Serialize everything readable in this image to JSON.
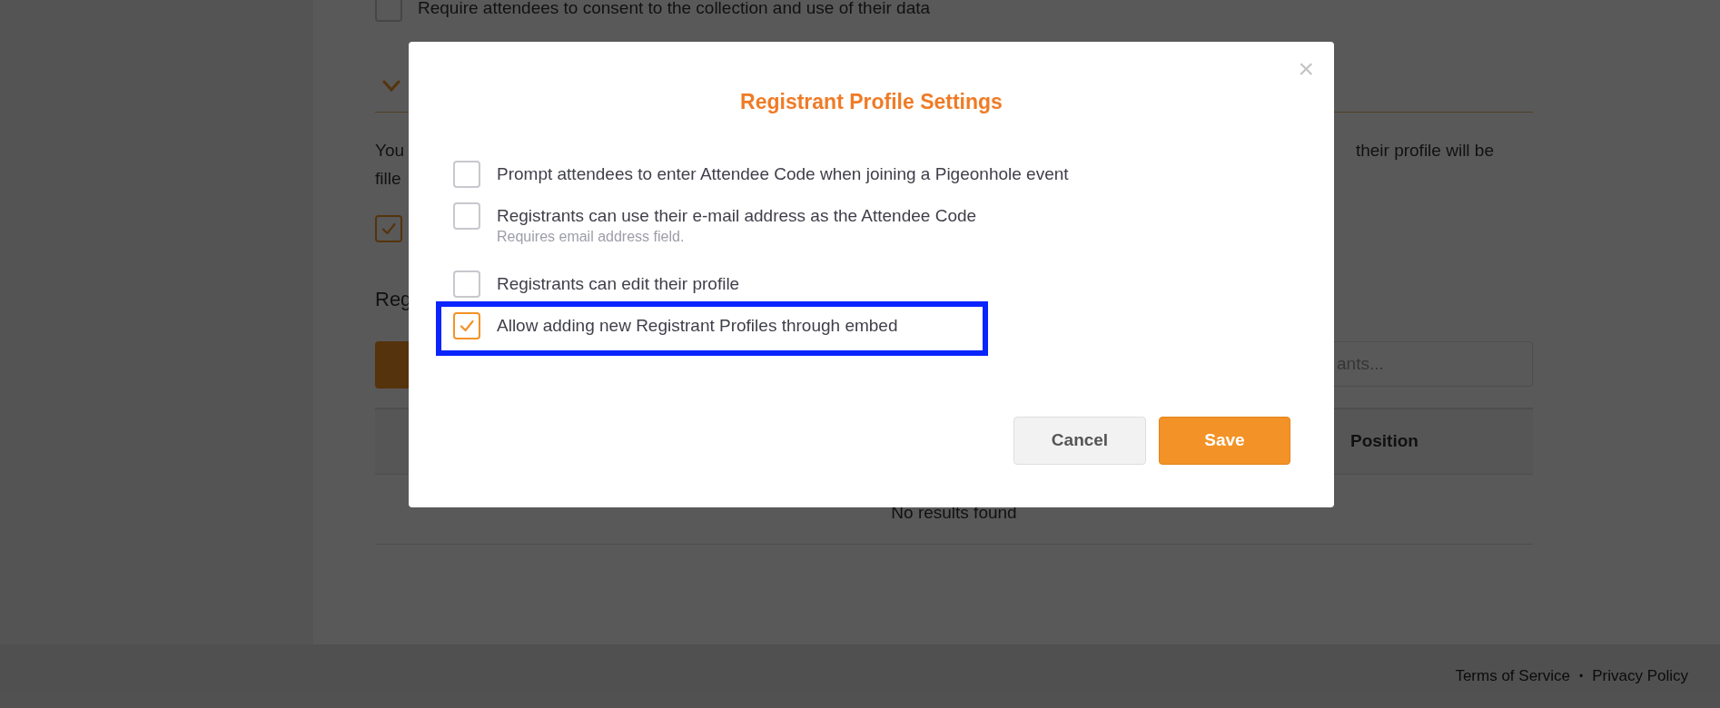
{
  "background": {
    "consent_option": {
      "label": "Require attendees to consent to the collection and use of their data",
      "checked": false
    },
    "description_fragments": [
      "You",
      "their profile will be",
      "fille"
    ],
    "profile_option": {
      "checked": true
    },
    "registrants_heading": "Reg",
    "search": {
      "placeholder": "ants..."
    },
    "table": {
      "columns": [
        "Position"
      ],
      "empty_message": "No results found"
    }
  },
  "modal": {
    "title": "Registrant Profile Settings",
    "close": "×",
    "options": [
      {
        "label": "Prompt attendees to enter Attendee Code when joining a Pigeonhole event",
        "checked": false,
        "highlighted": false
      },
      {
        "label": "Registrants can use their e-mail address as the Attendee Code",
        "hint": "Requires email address field.",
        "checked": false,
        "highlighted": false
      },
      {
        "label": "Registrants can edit their profile",
        "checked": false,
        "highlighted": false
      },
      {
        "label": "Allow adding new Registrant Profiles through embed",
        "checked": true,
        "highlighted": true
      }
    ],
    "buttons": [
      {
        "label": "Cancel",
        "kind": "secondary"
      },
      {
        "label": "Save",
        "kind": "primary"
      }
    ]
  },
  "footer": {
    "links": [
      "Terms of Service",
      "Privacy Policy"
    ],
    "separator": "•"
  }
}
